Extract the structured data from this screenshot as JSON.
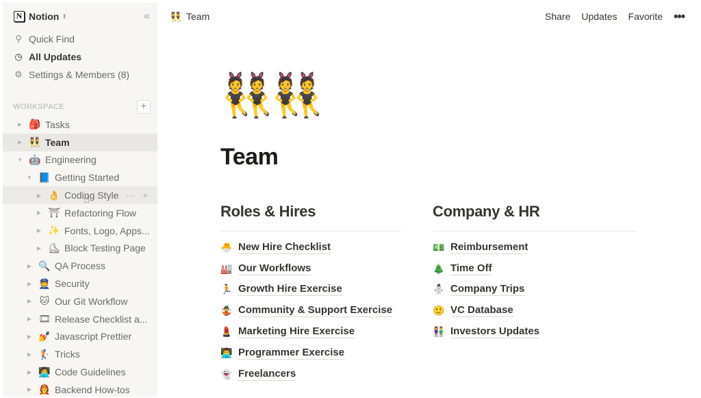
{
  "sidebar": {
    "workspace_name": "Notion",
    "logo_letter": "N",
    "collapse_icon": "«",
    "nav": [
      {
        "label": "Quick Find",
        "icon": "⚲",
        "bold": false
      },
      {
        "label": "All Updates",
        "icon": "◷",
        "bold": true
      },
      {
        "label": "Settings & Members (8)",
        "icon": "⚙",
        "bold": false
      }
    ],
    "section_label": "WORKSPACE",
    "add_icon": "+",
    "tree": [
      {
        "label": "Tasks",
        "emoji": "🎒",
        "level": 0,
        "expanded": false,
        "state": ""
      },
      {
        "label": "Team",
        "emoji": "👯",
        "level": 0,
        "expanded": false,
        "state": "active"
      },
      {
        "label": "Engineering",
        "emoji": "🤖",
        "level": 0,
        "expanded": true,
        "state": ""
      },
      {
        "label": "Getting Started",
        "emoji": "📘",
        "level": 1,
        "expanded": true,
        "state": ""
      },
      {
        "label": "Coding Style",
        "emoji": "👌",
        "level": 2,
        "expanded": false,
        "state": "hover"
      },
      {
        "label": "Refactoring Flow",
        "emoji": "⛩",
        "level": 2,
        "expanded": false,
        "state": ""
      },
      {
        "label": "Fonts, Logo, Apps...",
        "emoji": "✨",
        "level": 2,
        "expanded": false,
        "state": ""
      },
      {
        "label": "Block Testing Page",
        "emoji": "⛸",
        "level": 2,
        "expanded": false,
        "state": ""
      },
      {
        "label": "QA Process",
        "emoji": "🔍",
        "level": 1,
        "expanded": false,
        "state": ""
      },
      {
        "label": "Security",
        "emoji": "👮",
        "level": 1,
        "expanded": false,
        "state": ""
      },
      {
        "label": "Our Git Workflow",
        "emoji": "🐱",
        "level": 1,
        "expanded": false,
        "state": ""
      },
      {
        "label": "Release Checklist a...",
        "emoji": "🎞",
        "level": 1,
        "expanded": false,
        "state": ""
      },
      {
        "label": "Javascript Prettier",
        "emoji": "💅",
        "level": 1,
        "expanded": false,
        "state": ""
      },
      {
        "label": "Tricks",
        "emoji": "🏌",
        "level": 1,
        "expanded": false,
        "state": ""
      },
      {
        "label": "Code Guidelines",
        "emoji": "👩‍💻",
        "level": 1,
        "expanded": false,
        "state": ""
      },
      {
        "label": "Backend How-tos",
        "emoji": "👩‍🚒",
        "level": 1,
        "expanded": false,
        "state": ""
      }
    ],
    "row_actions": {
      "more": "···",
      "add": "+"
    }
  },
  "topbar": {
    "breadcrumb": {
      "emoji": "👯",
      "label": "Team"
    },
    "actions": [
      "Share",
      "Updates",
      "Favorite"
    ],
    "more_icon": "•••"
  },
  "page": {
    "icon": "👯",
    "title": "Team",
    "columns": [
      {
        "heading": "Roles & Hires",
        "links": [
          {
            "emoji": "🐣",
            "label": "New Hire Checklist"
          },
          {
            "emoji": "🏭",
            "label": "Our Workflows"
          },
          {
            "emoji": "🏃",
            "label": "Growth Hire Exercise"
          },
          {
            "emoji": "🤹",
            "label": "Community & Support Exercise"
          },
          {
            "emoji": "💄",
            "label": "Marketing Hire Exercise"
          },
          {
            "emoji": "👨‍💻",
            "label": "Programmer Exercise"
          },
          {
            "emoji": "👻",
            "label": "Freelancers"
          }
        ]
      },
      {
        "heading": "Company & HR",
        "links": [
          {
            "emoji": "💵",
            "label": "Reimbursement"
          },
          {
            "emoji": "🎄",
            "label": "Time Off"
          },
          {
            "emoji": "⛄",
            "label": "Company Trips"
          },
          {
            "emoji": "🙂",
            "label": "VC Database"
          },
          {
            "emoji": "👫",
            "label": "Investors Updates"
          }
        ]
      }
    ]
  }
}
